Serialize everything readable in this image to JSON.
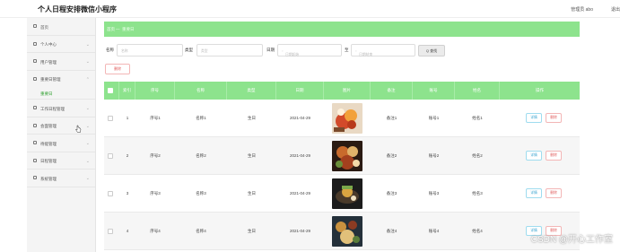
{
  "header": {
    "app_title": "个人日程安排微信小程序",
    "admin_label": "管理员 abo",
    "logout_label": "退出"
  },
  "sidebar": {
    "items": [
      {
        "label": "首页",
        "icon": "home-icon"
      },
      {
        "label": "个人中心",
        "icon": "user-icon"
      },
      {
        "label": "用户管理",
        "icon": "grid-icon"
      },
      {
        "label": "重要日管理",
        "icon": "calendar-icon"
      },
      {
        "label": "工作日程管理",
        "icon": "doc-icon"
      },
      {
        "label": "会面管理",
        "icon": "flag-icon"
      },
      {
        "label": "待能管理",
        "icon": "chat-icon"
      },
      {
        "label": "日程管理",
        "icon": "bag-icon"
      },
      {
        "label": "系统管理",
        "icon": "gear-icon"
      }
    ],
    "active_sub": "重要日"
  },
  "breadcrumb": {
    "home": "首页",
    "separator": "—",
    "current": "重要日"
  },
  "filters": {
    "name_label": "名称",
    "name_placeholder": "名称",
    "type_label": "类型",
    "type_placeholder": "类型",
    "date_label": "日期",
    "date_start_placeholder": "日期起始",
    "to_label": "至",
    "date_end_placeholder": "日期结束",
    "search_label": "Q 查找"
  },
  "toolbar": {
    "delete_label": "删除"
  },
  "table": {
    "headers": [
      "索引",
      "序号",
      "名称",
      "类型",
      "日期",
      "图片",
      "备注",
      "账号",
      "姓名",
      "操作"
    ],
    "rows": [
      {
        "index": "1",
        "serial": "序号1",
        "name": "名称1",
        "type": "生日",
        "date": "2021-04-29",
        "note": "备注1",
        "account": "账号1",
        "person": "姓名1"
      },
      {
        "index": "2",
        "serial": "序号2",
        "name": "名称2",
        "type": "生日",
        "date": "2021-04-29",
        "note": "备注2",
        "account": "账号2",
        "person": "姓名2"
      },
      {
        "index": "3",
        "serial": "序号3",
        "name": "名称3",
        "type": "生日",
        "date": "2021-04-29",
        "note": "备注3",
        "account": "账号3",
        "person": "姓名3"
      },
      {
        "index": "4",
        "serial": "序号4",
        "name": "名称4",
        "type": "生日",
        "date": "2021-04-29",
        "note": "备注4",
        "account": "账号4",
        "person": "姓名4"
      }
    ],
    "detail_label": "详情",
    "row_delete_label": "删除"
  },
  "watermark": "CSDN @开心工作室",
  "colors": {
    "accent_green": "#8de38d",
    "danger": "#e05b5b",
    "info": "#3aa4d0"
  }
}
